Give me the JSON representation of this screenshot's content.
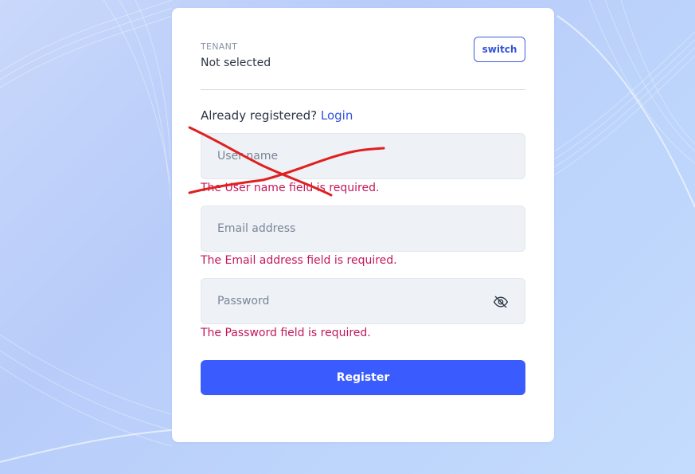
{
  "tenant": {
    "label": "TENANT",
    "value": "Not selected",
    "switch_label": "switch"
  },
  "prompt": {
    "text": "Already registered?",
    "login_label": "Login"
  },
  "form": {
    "username": {
      "placeholder": "User name",
      "error": "The User name field is required."
    },
    "email": {
      "placeholder": "Email address",
      "error": "The Email address field is required."
    },
    "password": {
      "placeholder": "Password",
      "error": "The Password field is required."
    },
    "register_label": "Register"
  },
  "icons": {
    "password_toggle": "eye-off-icon"
  },
  "colors": {
    "accent": "#3a5cff",
    "link": "#3554d6",
    "error": "#c2185b",
    "annotation": "#e02020"
  }
}
